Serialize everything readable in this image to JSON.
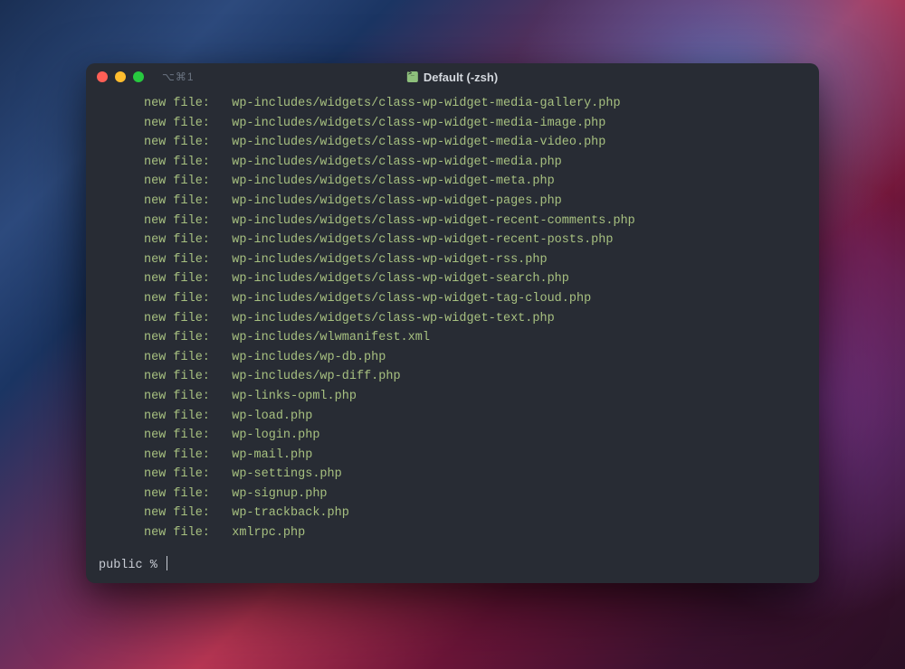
{
  "titlebar": {
    "shortcut": "⌥⌘1",
    "title": "Default (-zsh)"
  },
  "output": {
    "label": "new file:",
    "files": [
      "wp-includes/widgets/class-wp-widget-media-gallery.php",
      "wp-includes/widgets/class-wp-widget-media-image.php",
      "wp-includes/widgets/class-wp-widget-media-video.php",
      "wp-includes/widgets/class-wp-widget-media.php",
      "wp-includes/widgets/class-wp-widget-meta.php",
      "wp-includes/widgets/class-wp-widget-pages.php",
      "wp-includes/widgets/class-wp-widget-recent-comments.php",
      "wp-includes/widgets/class-wp-widget-recent-posts.php",
      "wp-includes/widgets/class-wp-widget-rss.php",
      "wp-includes/widgets/class-wp-widget-search.php",
      "wp-includes/widgets/class-wp-widget-tag-cloud.php",
      "wp-includes/widgets/class-wp-widget-text.php",
      "wp-includes/wlwmanifest.xml",
      "wp-includes/wp-db.php",
      "wp-includes/wp-diff.php",
      "wp-links-opml.php",
      "wp-load.php",
      "wp-login.php",
      "wp-mail.php",
      "wp-settings.php",
      "wp-signup.php",
      "wp-trackback.php",
      "xmlrpc.php"
    ]
  },
  "prompt": {
    "text": "public % "
  }
}
